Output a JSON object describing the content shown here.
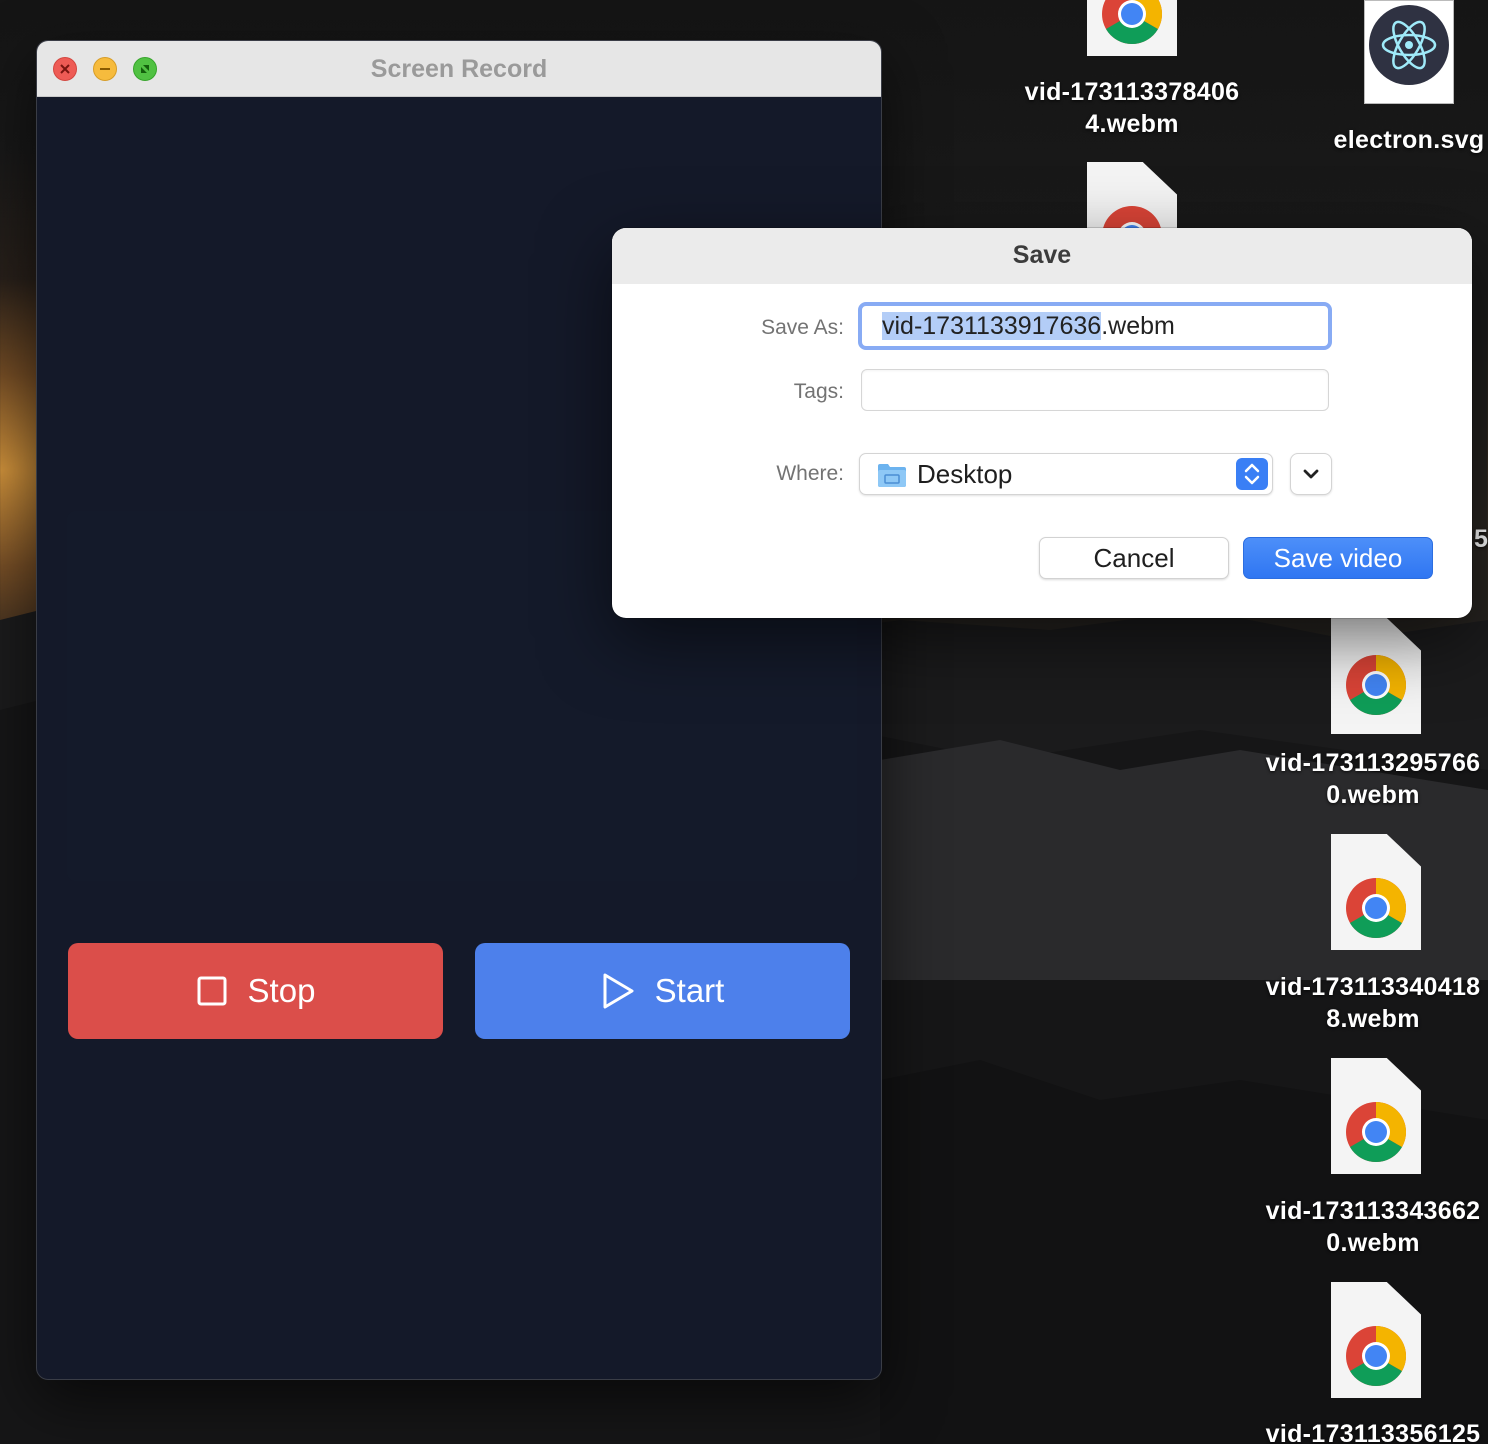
{
  "desktop": {
    "files": [
      {
        "line1": "vid-173113378406",
        "line2": "4.webm"
      },
      {
        "line1": "electron.svg",
        "line2": ""
      },
      {
        "line1": "vid-173113295766",
        "line2": "0.webm"
      },
      {
        "line1": "vid-173113340418",
        "line2": "8.webm"
      },
      {
        "line1": "vid-173113343662",
        "line2": "0.webm"
      },
      {
        "line1": "vid-173113356125",
        "line2": ""
      }
    ],
    "partial_label": "5"
  },
  "app": {
    "title": "Screen Record",
    "stop_label": "Stop",
    "start_label": "Start",
    "colors": {
      "stop": "#db4e4a",
      "start": "#4d80eb",
      "background": "#141929"
    }
  },
  "dialog": {
    "title": "Save",
    "save_as_label": "Save As:",
    "filename_selected": "vid-1731133917636",
    "filename_ext": ".webm",
    "tags_label": "Tags:",
    "tags_value": "",
    "where_label": "Where:",
    "where_value": "Desktop",
    "cancel_label": "Cancel",
    "save_label": "Save video"
  },
  "icons": {
    "close": "close-icon",
    "minimize": "minimize-icon",
    "fullscreen": "fullscreen-icon",
    "stop": "square-stop-icon",
    "start": "play-icon",
    "folder": "folder-icon",
    "stepper": "up-down-chevrons-icon",
    "expand": "chevron-down-icon",
    "file": "chrome-document-icon",
    "electron": "electron-logo-icon"
  }
}
